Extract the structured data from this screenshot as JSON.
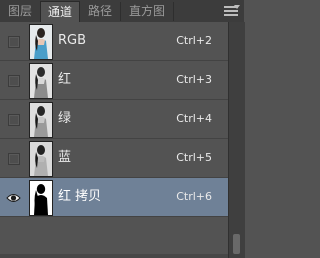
{
  "tabs": [
    {
      "label": "图层",
      "active": false
    },
    {
      "label": "通道",
      "active": true
    },
    {
      "label": "路径",
      "active": false
    },
    {
      "label": "直方图",
      "active": false
    }
  ],
  "channels": [
    {
      "name": "RGB",
      "shortcut": "Ctrl+2",
      "visible": false,
      "selected": false,
      "thumb": "color"
    },
    {
      "name": "红",
      "shortcut": "Ctrl+3",
      "visible": false,
      "selected": false,
      "thumb": "gray"
    },
    {
      "name": "绿",
      "shortcut": "Ctrl+4",
      "visible": false,
      "selected": false,
      "thumb": "gray"
    },
    {
      "name": "蓝",
      "shortcut": "Ctrl+5",
      "visible": false,
      "selected": false,
      "thumb": "gray"
    },
    {
      "name": "红 拷贝",
      "shortcut": "Ctrl+6",
      "visible": true,
      "selected": true,
      "thumb": "mask"
    }
  ],
  "colors": {
    "panel_bg": "#535353",
    "selected_row": "#6f8197",
    "tab_bar": "#3c3c3c"
  }
}
